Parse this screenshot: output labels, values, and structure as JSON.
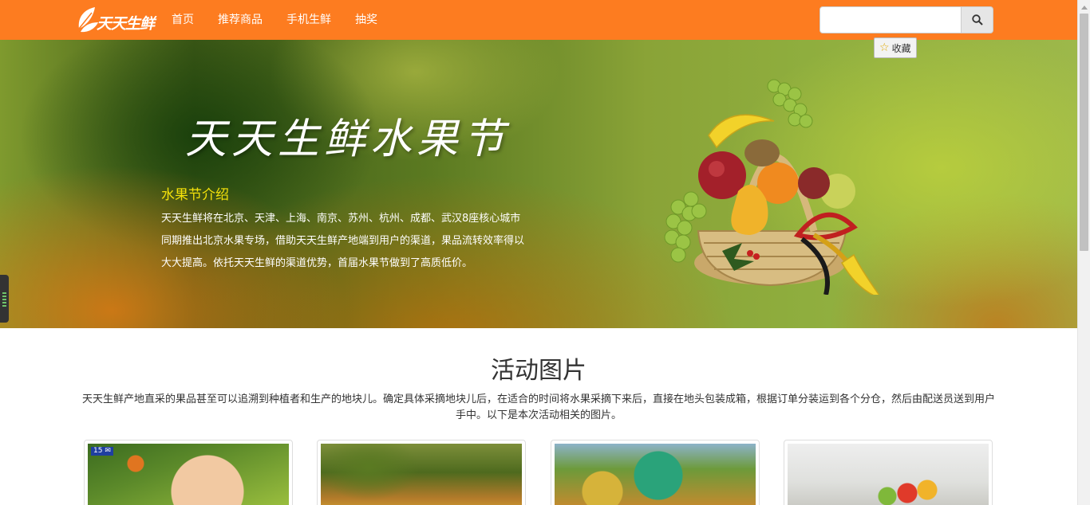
{
  "navbar": {
    "logo_text": "天天生鲜",
    "items": [
      "首页",
      "推荐商品",
      "手机生鲜",
      "抽奖"
    ],
    "search": {
      "placeholder": "",
      "value": ""
    }
  },
  "favorite_button": {
    "label": "收藏"
  },
  "banner": {
    "title": "天天生鲜水果节",
    "subtitle": "水果节介绍",
    "description": "天天生鲜将在北京、天津、上海、南京、苏州、杭州、成都、武汉8座核心城市同期推出北京水果专场，借助天天生鲜产地端到用户的渠道，果品流转效率得以大大提高。依托天天生鲜的渠道优势，首届水果节做到了高质低价。"
  },
  "activity": {
    "title": "活动图片",
    "description": "天天生鲜产地直采的果品甚至可以追溯到种植者和生产的地块儿。确定具体采摘地块儿后，在适合的时间将水果采摘下来后，直接在地头包装成箱，根据订单分装运到各个分仓，然后由配送员送到用户手中。以下是本次活动相关的图片。",
    "first_image_badge": "15 ✉"
  },
  "colors": {
    "navbar": "#fd7c20",
    "banner_subtitle": "#f5e20a"
  }
}
